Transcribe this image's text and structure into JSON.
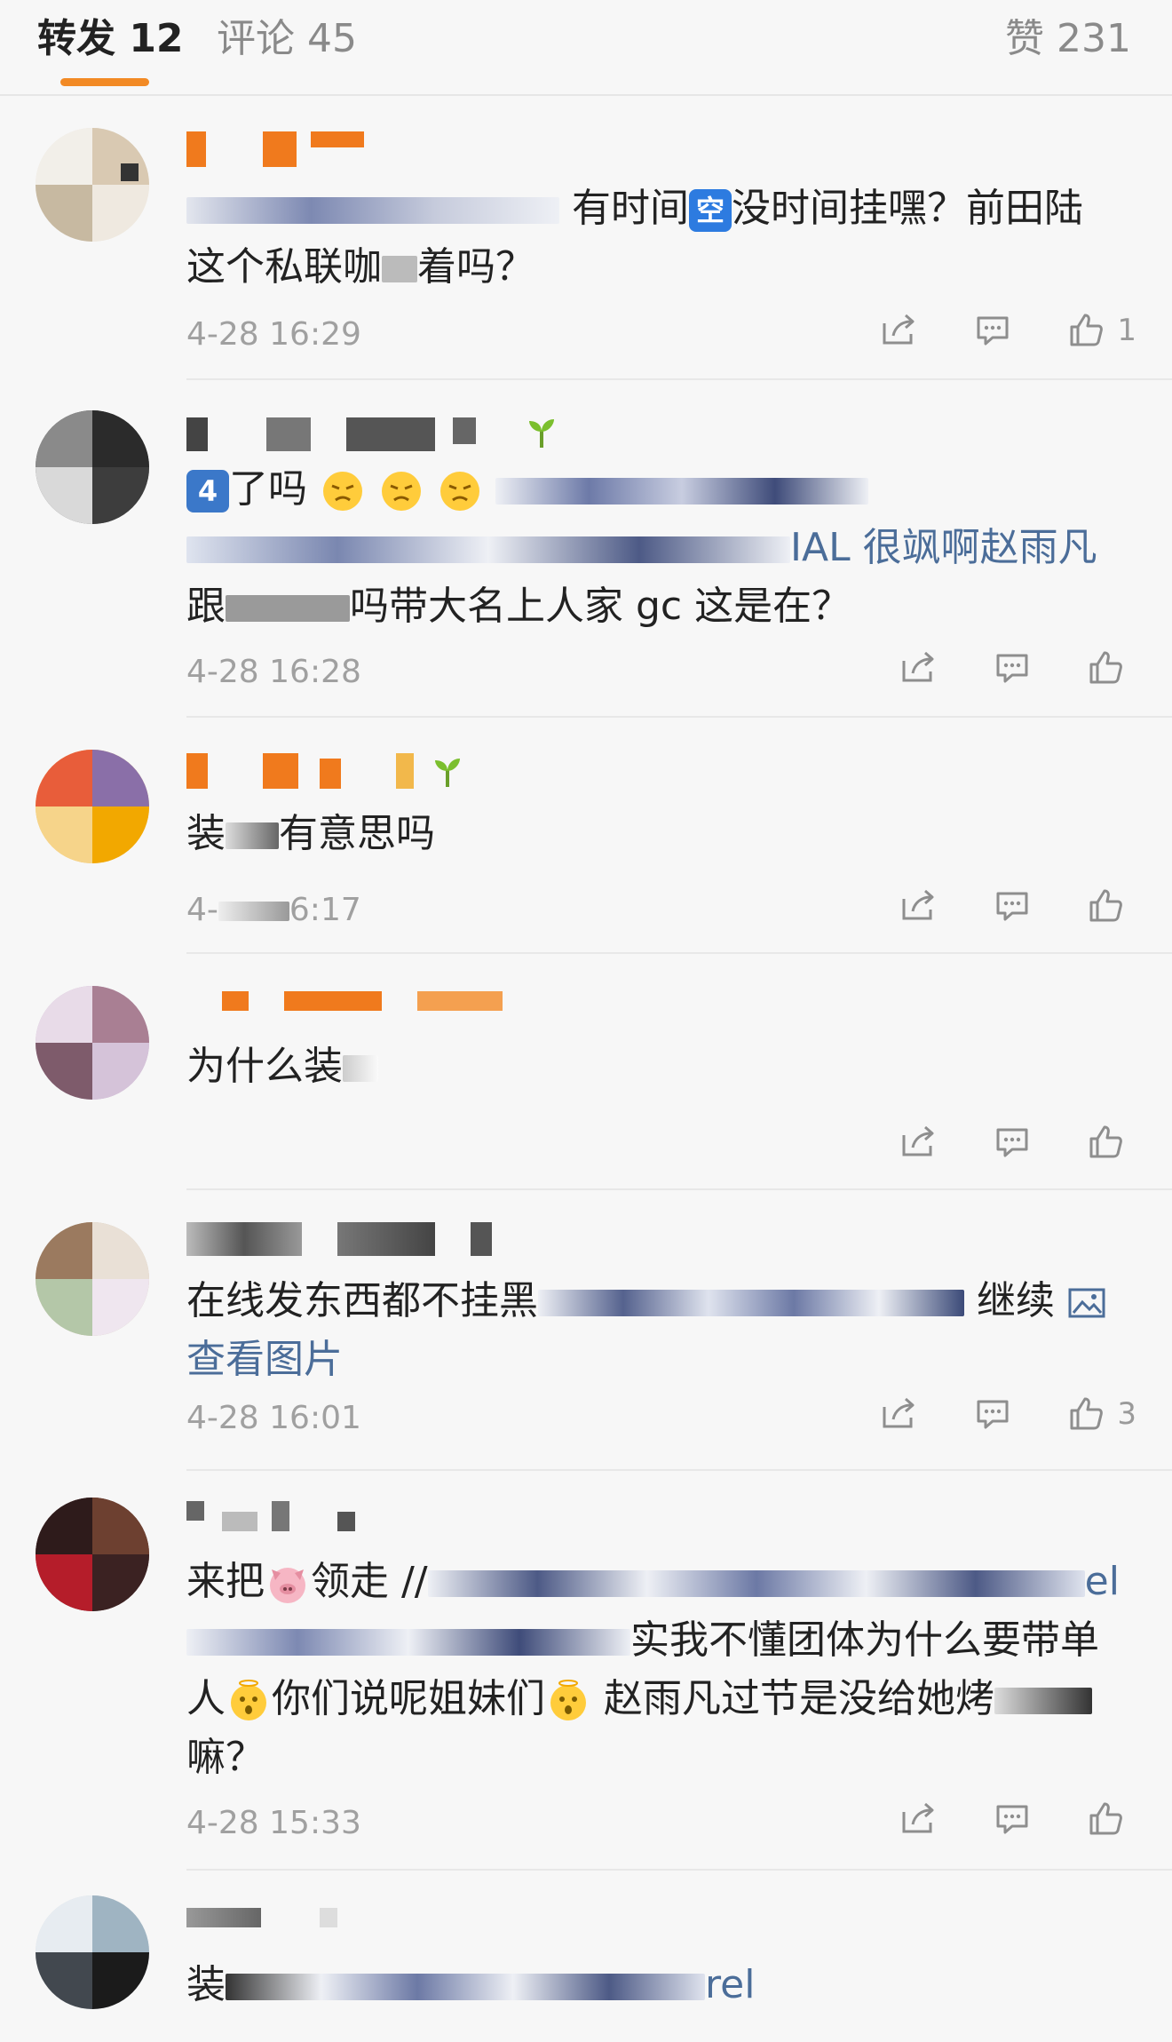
{
  "tabs": {
    "repost": "转发 12",
    "comments": "评论 45",
    "likes": "赞 231"
  },
  "colors": {
    "accent": "#f28a25",
    "link": "#4b6d99",
    "meta": "#a0a0a0"
  },
  "icons": [
    "share-icon",
    "comment-icon",
    "like-icon",
    "image-icon",
    "seedling-icon"
  ],
  "comments": [
    {
      "text_a": "有时间",
      "badge": "空",
      "text_b": "没时间挂嘿？前田陆",
      "text_c": "这个私联咖",
      "text_d": "着吗？",
      "time": "4-28 16:29",
      "likes": "1"
    },
    {
      "badge": "4",
      "text_a": "了吗",
      "text_b": "IAL 很飒啊赵雨凡",
      "text_c": "跟",
      "text_d": "吗带大名上人家 gc 这是在？",
      "time": "4-28 16:28",
      "likes": ""
    },
    {
      "text_a": "装",
      "text_b": "有意思吗",
      "time_a": "4-",
      "time_b": "6:17",
      "likes": ""
    },
    {
      "text_a": "为什么装",
      "likes": ""
    },
    {
      "text_a": "在线发东西都不挂黑",
      "text_b": "继续",
      "text_c": "查看图片",
      "time": "4-28 16:01",
      "likes": "3"
    },
    {
      "text_a": "来把",
      "text_b": "领走 //",
      "text_c": "el",
      "text_d": "实我不懂团体为什么要带单",
      "text_e": "人",
      "text_f": "你们说呢姐妹们",
      "text_g": "赵雨凡过节是没给她烤",
      "text_h": "嘛？",
      "time": "4-28 15:33",
      "likes": ""
    },
    {
      "text_a": "装",
      "text_b": "rel"
    }
  ]
}
